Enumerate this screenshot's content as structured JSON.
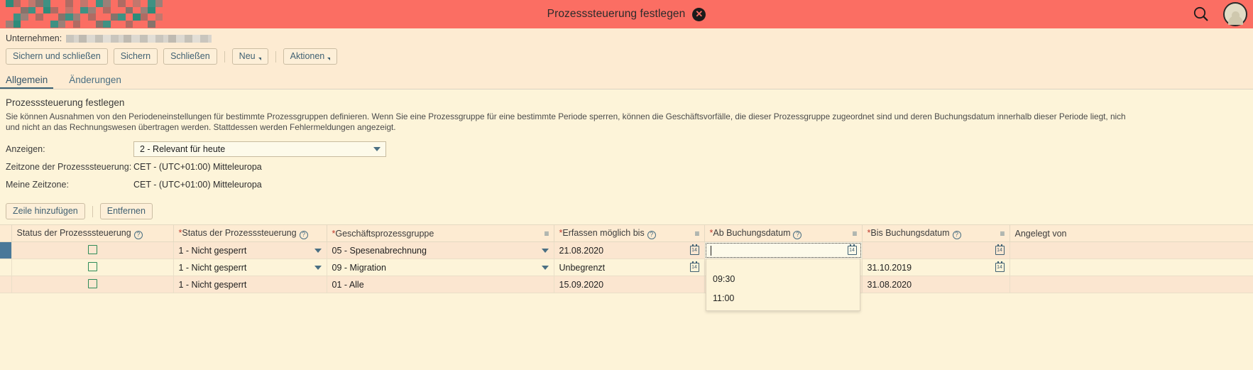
{
  "topbar": {
    "title": "Prozesssteuerung festlegen",
    "close_label": "✕",
    "search_icon": "search-icon",
    "avatar_icon": "user-avatar-icon",
    "bg_color": "#fb6e63"
  },
  "company": {
    "label": "Unternehmen:",
    "value_redacted": ""
  },
  "toolbar": {
    "save_and_close": "Sichern und schließen",
    "save": "Sichern",
    "close": "Schließen",
    "new": "Neu",
    "actions": "Aktionen"
  },
  "tabs": [
    {
      "label": "Allgemein",
      "active": true
    },
    {
      "label": "Änderungen",
      "active": false
    }
  ],
  "main": {
    "section_title": "Prozesssteuerung festlegen",
    "description_line1": "Sie können Ausnahmen von den Periodeneinstellungen für bestimmte Prozessgruppen definieren. Wenn Sie eine Prozessgruppe für eine bestimmte Periode sperren, können die Geschäftsvorfälle, die dieser Prozessgruppe zugeordnet sind und deren Buchungsdatum innerhalb dieser Periode liegt, nich",
    "description_line2": "und nicht an das Rechnungswesen übertragen werden. Stattdessen werden Fehlermeldungen angezeigt.",
    "fields": [
      {
        "label": "Anzeigen:",
        "value": "2 - Relevant für heute",
        "type": "select"
      },
      {
        "label": "Zeitzone der Prozesssteuerung:",
        "value": "CET - (UTC+01:00) Mitteleuropa",
        "type": "text"
      },
      {
        "label": "Meine Zeitzone:",
        "value": "CET - (UTC+01:00) Mitteleuropa",
        "type": "text"
      }
    ],
    "table_toolbar": {
      "add_row": "Zeile hinzufügen",
      "remove": "Entfernen"
    }
  },
  "table": {
    "columns": [
      {
        "label": "Status der Prozesssteuerung",
        "required": false,
        "help": true,
        "sort": false
      },
      {
        "label": "Status der Prozesssteuerung",
        "required": true,
        "help": true,
        "sort": false
      },
      {
        "label": "Geschäftsprozessgruppe",
        "required": true,
        "help": false,
        "sort": true
      },
      {
        "label": "Erfassen möglich bis",
        "required": true,
        "help": true,
        "sort": true
      },
      {
        "label": "Ab Buchungsdatum",
        "required": true,
        "help": true,
        "sort": true
      },
      {
        "label": "Bis Buchungsdatum",
        "required": true,
        "help": true,
        "sort": true
      },
      {
        "label": "Angelegt von",
        "required": false,
        "help": false,
        "sort": false
      }
    ],
    "rows": [
      {
        "selected": true,
        "checkbox": false,
        "status": "1 - Nicht gesperrt",
        "group": "05 - Spesenabrechnung",
        "capture_until": "21.08.2020",
        "posting_from": "",
        "posting_to": "",
        "created_by": ""
      },
      {
        "selected": false,
        "checkbox": false,
        "status": "1 - Nicht gesperrt",
        "group": "09 - Migration",
        "capture_until": "Unbegrenzt",
        "posting_from": "",
        "posting_to": "31.10.2019",
        "created_by": ""
      },
      {
        "selected": false,
        "checkbox": false,
        "status": "1 - Nicht gesperrt",
        "group": "01 - Alle",
        "capture_until": "15.09.2020",
        "posting_from": "",
        "posting_to": "31.08.2020",
        "created_by": ""
      }
    ],
    "calendar_icon_label": "14"
  },
  "suggestions": {
    "options": [
      "09:30",
      "11:00"
    ]
  }
}
